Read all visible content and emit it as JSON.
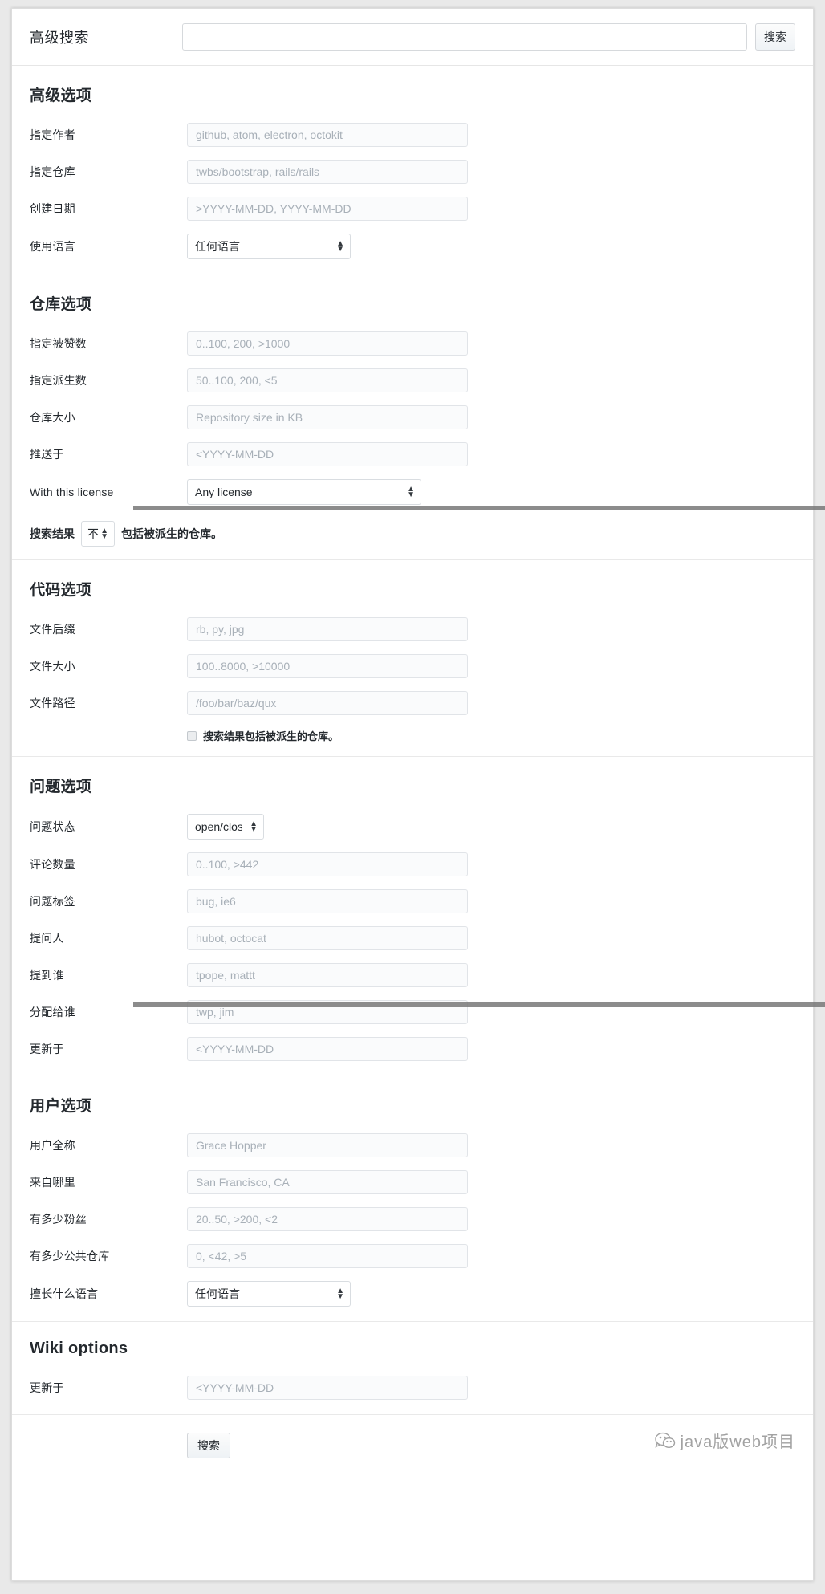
{
  "header": {
    "label": "高级搜索",
    "search_value": "",
    "search_placeholder": "",
    "search_button": "搜索"
  },
  "sections": [
    {
      "id": "advanced-options",
      "title": "高级选项",
      "rows": [
        {
          "label": "指定作者",
          "type": "text",
          "placeholder": "github, atom, electron, octokit",
          "value": ""
        },
        {
          "label": "指定仓库",
          "type": "text",
          "placeholder": "twbs/bootstrap, rails/rails",
          "value": ""
        },
        {
          "label": "创建日期",
          "type": "text",
          "placeholder": ">YYYY-MM-DD, YYYY-MM-DD",
          "value": ""
        },
        {
          "label": "使用语言",
          "type": "select",
          "selected": "任何语言"
        }
      ]
    },
    {
      "id": "repository-options",
      "title": "仓库选项",
      "rows": [
        {
          "label": "指定被赞数",
          "type": "text",
          "placeholder": "0..100, 200, >1000",
          "value": ""
        },
        {
          "label": "指定派生数",
          "type": "text",
          "placeholder": "50..100, 200, <5",
          "value": ""
        },
        {
          "label": "仓库大小",
          "type": "text",
          "placeholder": "Repository size in KB",
          "value": ""
        },
        {
          "label": "推送于",
          "type": "text",
          "placeholder": "<YYYY-MM-DD",
          "value": ""
        },
        {
          "label": "With this license",
          "type": "select",
          "selected": "Any license"
        }
      ],
      "fork_sentence": {
        "prefix": "搜索结果",
        "selected": "不",
        "suffix": "包括被派生的仓库。"
      }
    },
    {
      "id": "code-options",
      "title": "代码选项",
      "rows": [
        {
          "label": "文件后缀",
          "type": "text",
          "placeholder": "rb, py, jpg",
          "value": ""
        },
        {
          "label": "文件大小",
          "type": "text",
          "placeholder": "100..8000, >10000",
          "value": ""
        },
        {
          "label": "文件路径",
          "type": "text",
          "placeholder": "/foo/bar/baz/qux",
          "value": ""
        }
      ],
      "checkbox": {
        "label": "搜索结果包括被派生的仓库。",
        "checked": false
      }
    },
    {
      "id": "issue-options",
      "title": "问题选项",
      "rows": [
        {
          "label": "问题状态",
          "type": "select",
          "selected": "open/closed"
        },
        {
          "label": "评论数量",
          "type": "text",
          "placeholder": "0..100, >442",
          "value": ""
        },
        {
          "label": "问题标签",
          "type": "text",
          "placeholder": "bug, ie6",
          "value": ""
        },
        {
          "label": "提问人",
          "type": "text",
          "placeholder": "hubot, octocat",
          "value": ""
        },
        {
          "label": "提到谁",
          "type": "text",
          "placeholder": "tpope, mattt",
          "value": ""
        },
        {
          "label": "分配给谁",
          "type": "text",
          "placeholder": "twp, jim",
          "value": ""
        },
        {
          "label": "更新于",
          "type": "text",
          "placeholder": "<YYYY-MM-DD",
          "value": ""
        }
      ]
    },
    {
      "id": "user-options",
      "title": "用户选项",
      "rows": [
        {
          "label": "用户全称",
          "type": "text",
          "placeholder": "Grace Hopper",
          "value": ""
        },
        {
          "label": "来自哪里",
          "type": "text",
          "placeholder": "San Francisco, CA",
          "value": ""
        },
        {
          "label": "有多少粉丝",
          "type": "text",
          "placeholder": "20..50, >200, <2",
          "value": ""
        },
        {
          "label": "有多少公共仓库",
          "type": "text",
          "placeholder": "0, <42, >5",
          "value": ""
        },
        {
          "label": "擅长什么语言",
          "type": "select",
          "selected": "任何语言"
        }
      ]
    },
    {
      "id": "wiki-options",
      "title": "Wiki options",
      "rows": [
        {
          "label": "更新于",
          "type": "text",
          "placeholder": "<YYYY-MM-DD",
          "value": ""
        }
      ]
    }
  ],
  "footer": {
    "search_button": "搜索"
  },
  "watermark": {
    "text": "java版web项目",
    "icon": "wechat-icon"
  },
  "colors": {
    "page_bg": "#e9e9e9",
    "sheet_bg": "#ffffff",
    "text": "#24292e",
    "field_bg": "#fafbfc",
    "field_border": "#e1e4e8",
    "placeholder": "#a8b0b8",
    "divider": "#e9e9e9",
    "scanbar": "#787878"
  }
}
